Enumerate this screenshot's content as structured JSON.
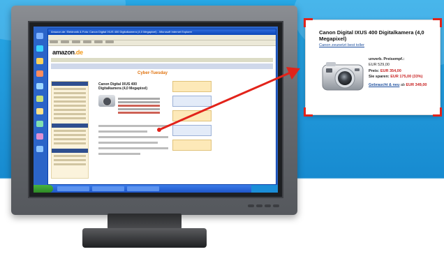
{
  "callout": {
    "title": "Canon Digital IXUS 400 Digitalkamera (4,0 Megapixel)",
    "link": "Canon zeunetzt best toller",
    "price_label": "unverb. Preisempf.:",
    "price_value": "EUR 529,00",
    "preis_label": "Preis:",
    "preis_value": "EUR 354,00",
    "sparen_label": "Sie sparen:",
    "sparen_value": "EUR 175,00 (33%)",
    "used_link": "Gebraucht & neu",
    "used_suffix": "ab",
    "used_price": "EUR 349,00"
  },
  "screen": {
    "window_title": "Amazon.de: Elektronik & Foto: Canon Digital IXUS 400 Digitalkamera (4,0 Megapixel) - Microsoft Internet Explorer",
    "logo_main": "amazon",
    "logo_suffix": ".de",
    "promo_text": "Cyber-Tuesday",
    "product_title": "Canon Digital IXUS 400 Digitalkamera (4,0 Megapixel)"
  },
  "colors": {
    "accent_red": "#e2231a",
    "link_blue": "#1d4f9e",
    "price_red": "#c71f1f",
    "amazon_orange": "#f39a1b"
  }
}
